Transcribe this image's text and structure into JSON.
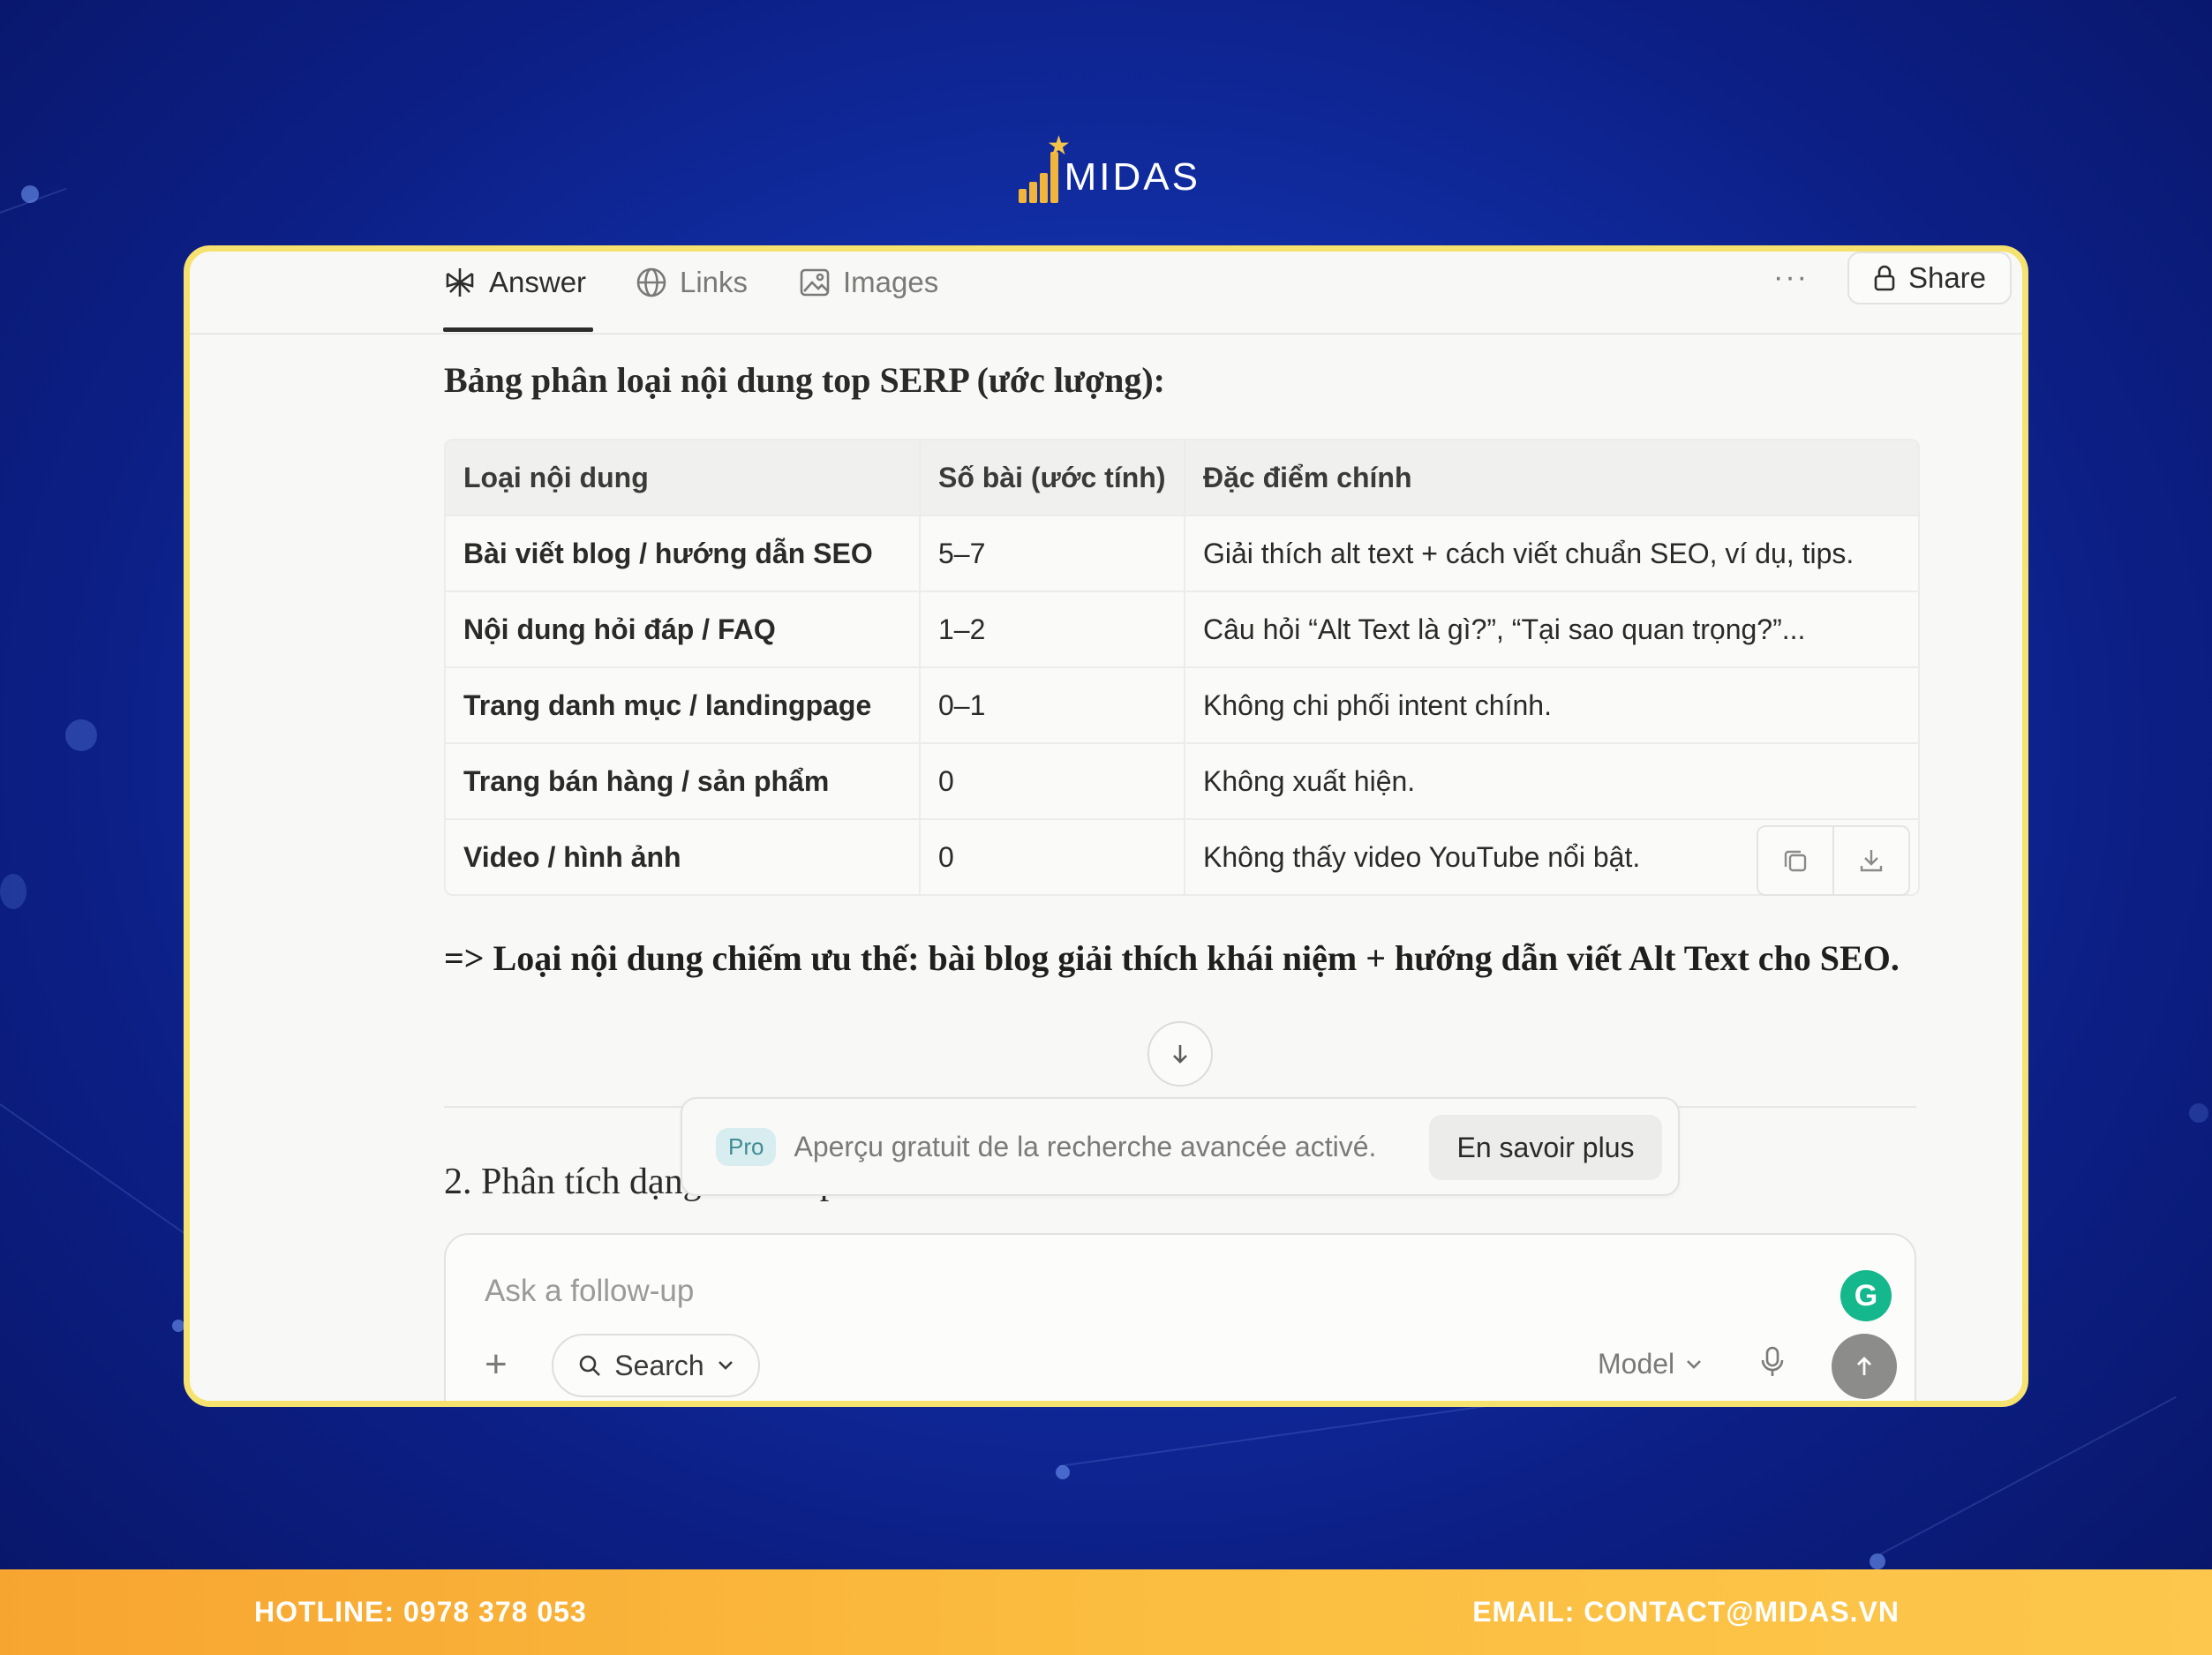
{
  "brand": {
    "logo_text": "MIDAS"
  },
  "tabs": [
    {
      "label": "Answer",
      "icon": "perplexity-icon"
    },
    {
      "label": "Links",
      "icon": "globe-icon"
    },
    {
      "label": "Images",
      "icon": "image-icon"
    }
  ],
  "toolbar": {
    "more_label": "···",
    "share_label": "Share"
  },
  "content": {
    "heading": "Bảng phân loại nội dung top SERP (ước lượng):",
    "table": {
      "headers": [
        "Loại nội dung",
        "Số bài (ước tính)",
        "Đặc điểm chính"
      ],
      "rows": [
        [
          "Bài viết blog / hướng dẫn SEO",
          "5–7",
          "Giải thích alt text + cách viết chuẩn SEO, ví dụ, tips."
        ],
        [
          "Nội dung hỏi đáp / FAQ",
          "1–2",
          "Câu hỏi “Alt Text là gì?”, “Tại sao quan trọng?”..."
        ],
        [
          "Trang danh mục / landingpage",
          "0–1",
          "Không chi phối intent chính."
        ],
        [
          "Trang bán hàng / sản phẩm",
          "0",
          "Không xuất hiện."
        ],
        [
          "Video / hình ảnh",
          "0",
          "Không thấy video YouTube nổi bật."
        ]
      ]
    },
    "conclusion": "=> Loại nội dung chiếm ưu thế: bài blog giải thích khái niệm + hướng dẫn viết Alt Text cho SEO.",
    "section2": "2. Phân tích dạng tiêu đề phổ biến"
  },
  "promo": {
    "badge": "Pro",
    "text": "Aperçu gratuit de la recherche avancée activé.",
    "button": "En savoir plus"
  },
  "composer": {
    "placeholder": "Ask a follow-up",
    "search_label": "Search",
    "model_label": "Model"
  },
  "footer": {
    "hotline": "HOTLINE: 0978 378 053",
    "email": "EMAIL: CONTACT@MIDAS.VN"
  },
  "colors": {
    "background": "#1230a8",
    "card_border": "#f6e26e",
    "footer": "#fbbd3f",
    "logo_gold": "#f2b53b"
  }
}
